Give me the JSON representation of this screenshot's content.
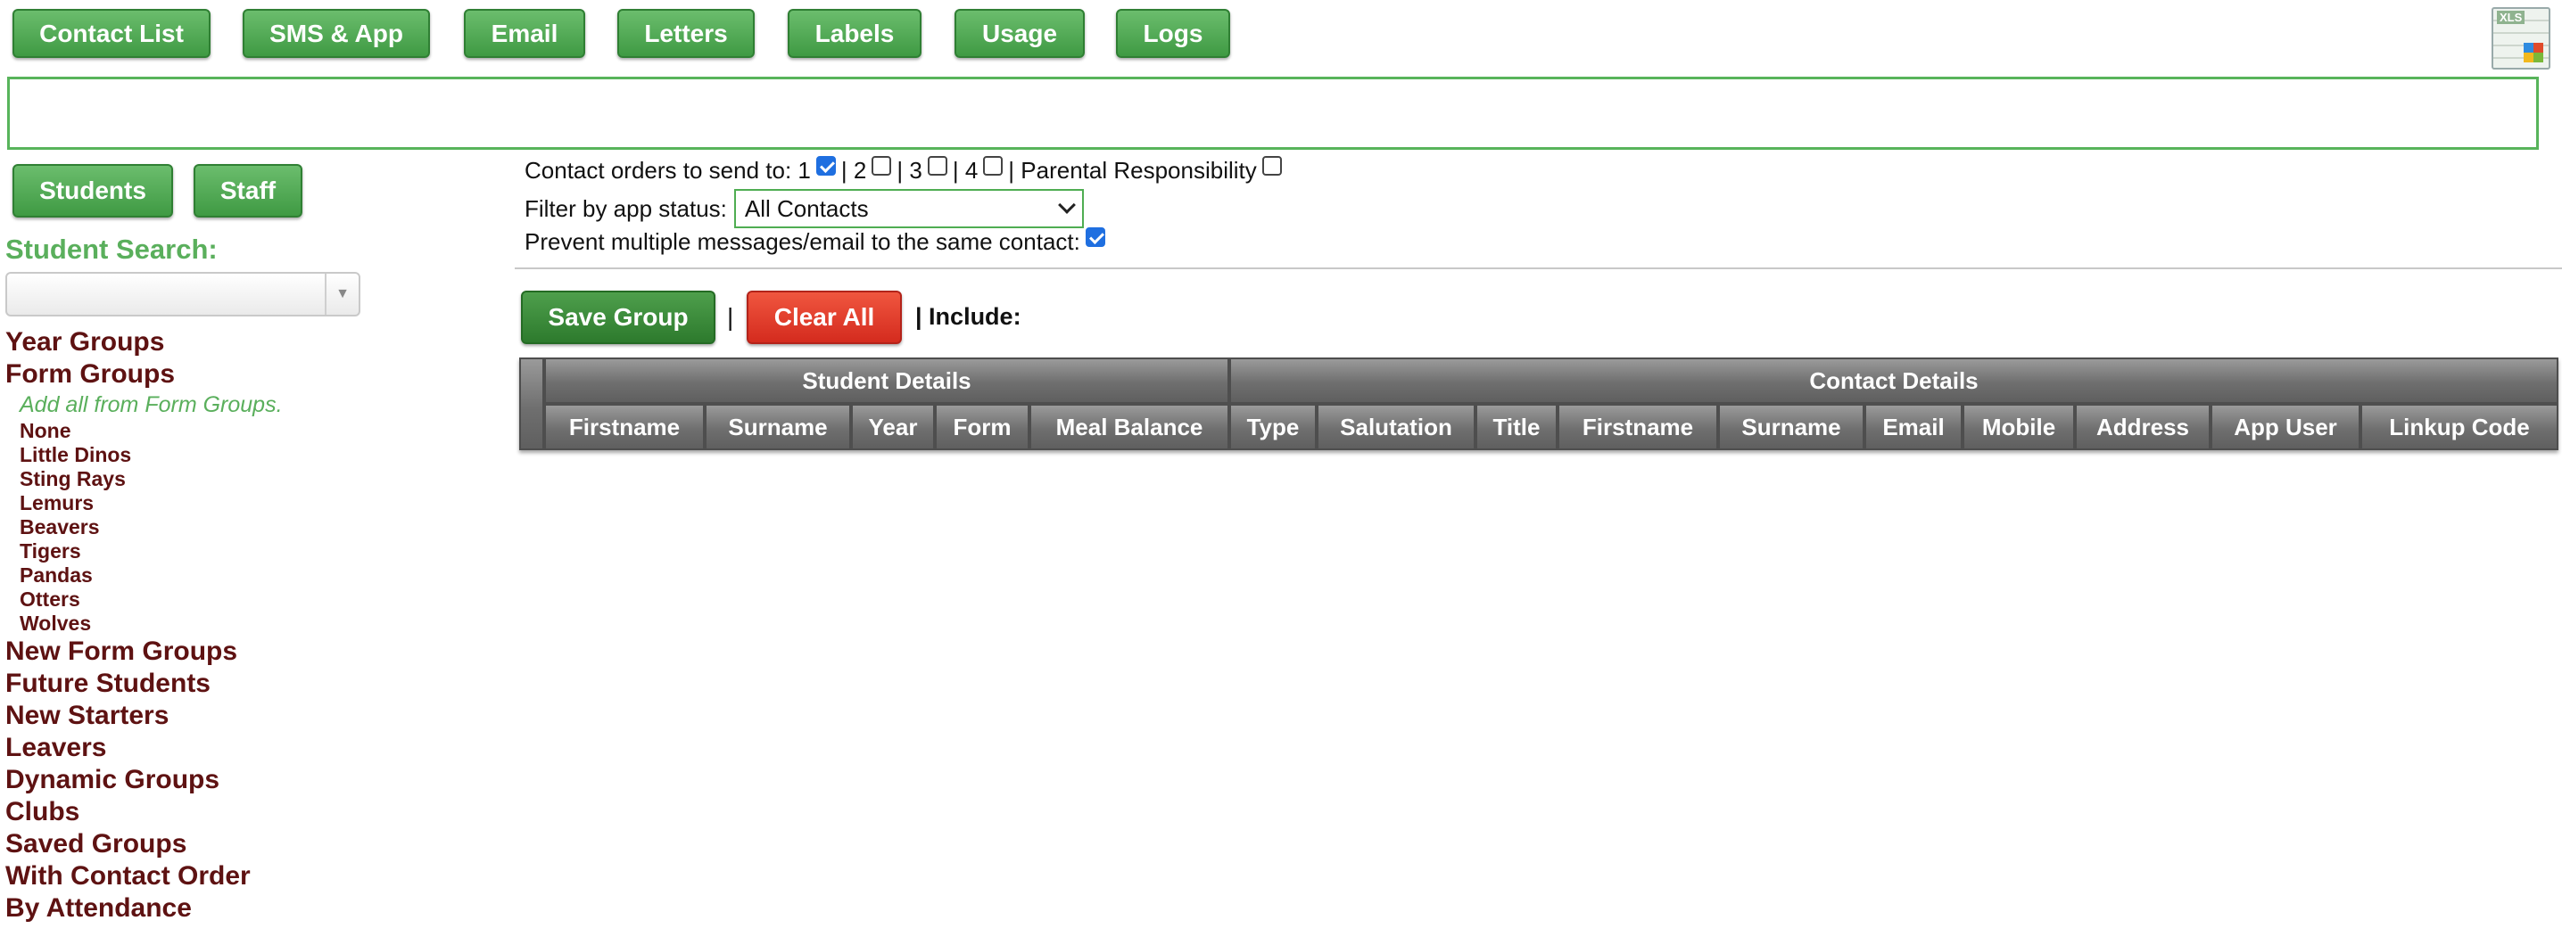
{
  "top_nav": [
    "Contact List",
    "SMS & App",
    "Email",
    "Letters",
    "Labels",
    "Usage",
    "Logs"
  ],
  "export": {
    "icon": "excel-export-icon",
    "label": "XLS"
  },
  "message_box": "",
  "audience_tabs": [
    "Students",
    "Staff"
  ],
  "student_search": {
    "title": "Student Search:",
    "value": ""
  },
  "groups": {
    "year_groups": "Year Groups",
    "form_groups": "Form Groups",
    "add_all": "Add all from Form Groups.",
    "forms": [
      "None",
      "Little Dinos",
      "Sting Rays",
      "Lemurs",
      "Beavers",
      "Tigers",
      "Pandas",
      "Otters",
      "Wolves"
    ],
    "more": [
      "New Form Groups",
      "Future Students",
      "New Starters",
      "Leavers",
      "Dynamic Groups",
      "Clubs",
      "Saved Groups",
      "With Contact Order",
      "By Attendance"
    ]
  },
  "options": {
    "contact_orders_label": "Contact orders to send to:",
    "orders": [
      {
        "label": "1",
        "checked": true
      },
      {
        "label": "2",
        "checked": false
      },
      {
        "label": "3",
        "checked": false
      },
      {
        "label": "4",
        "checked": false
      }
    ],
    "parental_label": "Parental Responsibility",
    "parental_checked": false,
    "filter_label": "Filter by app status:",
    "filter_value": "All Contacts",
    "prevent_label": "Prevent multiple messages/email to the same contact:",
    "prevent_checked": true
  },
  "actions": {
    "save": "Save Group",
    "clear": "Clear All",
    "include": "| Include:",
    "sep": "|"
  },
  "table": {
    "student_details": "Student Details",
    "contact_details": "Contact Details",
    "student_columns": [
      "Firstname",
      "Surname",
      "Year",
      "Form",
      "Meal Balance"
    ],
    "contact_columns": [
      "Type",
      "Salutation",
      "Title",
      "Firstname",
      "Surname",
      "Email",
      "Mobile",
      "Address",
      "App User",
      "Linkup Code"
    ]
  },
  "colors": {
    "nav_green": "#4fa652",
    "group_text": "#5e1212",
    "search_title": "#5aaf5c",
    "clear_red": "#e03a2a"
  }
}
